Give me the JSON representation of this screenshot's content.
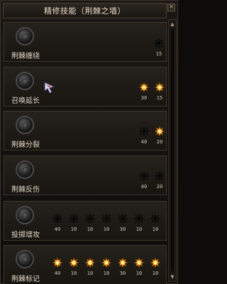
{
  "title": "精修技能（荆棘之墙）",
  "close_label": "×",
  "skills": [
    {
      "name": "荆棘缠绕",
      "stars": [
        {
          "lit": false,
          "value": "15"
        }
      ]
    },
    {
      "name": "召唤延长",
      "stars": [
        {
          "lit": true,
          "value": "30"
        },
        {
          "lit": true,
          "value": "15"
        }
      ]
    },
    {
      "name": "荆棘分裂",
      "stars": [
        {
          "lit": false,
          "value": "40"
        },
        {
          "lit": true,
          "value": "20"
        }
      ]
    },
    {
      "name": "荆棘反伤",
      "stars": [
        {
          "lit": false,
          "value": "40"
        },
        {
          "lit": false,
          "value": "20"
        }
      ]
    },
    {
      "name": "投掷增攻",
      "stars": [
        {
          "lit": false,
          "value": "40"
        },
        {
          "lit": false,
          "value": "10"
        },
        {
          "lit": false,
          "value": "10"
        },
        {
          "lit": false,
          "value": "10"
        },
        {
          "lit": false,
          "value": "30"
        },
        {
          "lit": false,
          "value": "10"
        },
        {
          "lit": false,
          "value": "10"
        }
      ]
    },
    {
      "name": "荆棘标记",
      "stars": [
        {
          "lit": true,
          "value": "40"
        },
        {
          "lit": true,
          "value": "10"
        },
        {
          "lit": true,
          "value": "10"
        },
        {
          "lit": true,
          "value": "10"
        },
        {
          "lit": true,
          "value": "30"
        },
        {
          "lit": true,
          "value": "10"
        },
        {
          "lit": true,
          "value": "10"
        }
      ]
    }
  ],
  "colors": {
    "star_lit": "#f0a020",
    "star_unlit": "#1a1a1a"
  }
}
